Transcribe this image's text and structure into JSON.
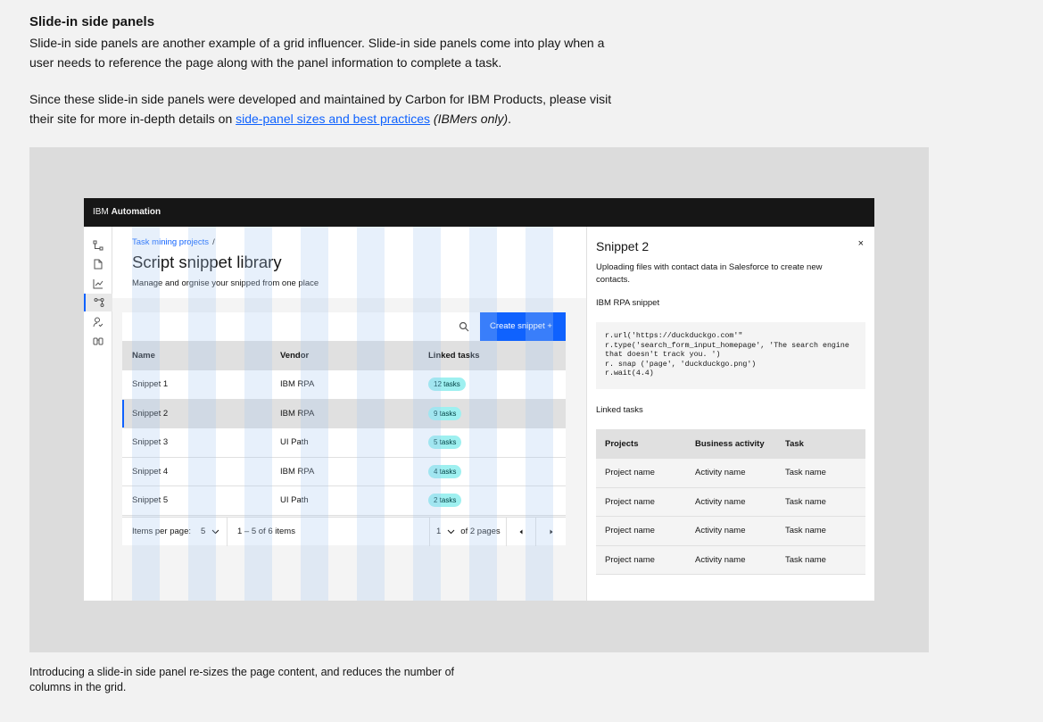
{
  "doc": {
    "heading": "Slide-in side panels",
    "para1": "Slide-in side panels are another example of a grid influencer. Slide-in side panels come into play when a user needs to reference the page along with the panel information to complete a task.",
    "para2_before": "Since these slide-in side panels were developed and maintained by Carbon for IBM Products, please visit their site for more in-depth details on ",
    "para2_link": "side-panel sizes and best practices",
    "para2_italic": "(IBMers only)",
    "para2_after": ".",
    "caption": "Introducing a slide-in side panel re-sizes the page content, and reduces the number of columns in the grid."
  },
  "app": {
    "brand_prefix": "IBM ",
    "brand_name": "Automation",
    "rail_icons": [
      "flow-icon",
      "document-icon",
      "chart-icon",
      "process-icon",
      "user-check-icon",
      "binoculars-icon"
    ],
    "breadcrumb": "Task mining projects",
    "breadcrumb_sep": "/",
    "title": "Script snippet library",
    "subtitle": "Manage and orgnise your snipped from one place",
    "create_button": "Create snippet +",
    "table": {
      "headers": [
        "Name",
        "Vendor",
        "Linked tasks"
      ],
      "rows": [
        {
          "name": "Snippet 1",
          "vendor": "IBM RPA",
          "tasks": "12 tasks"
        },
        {
          "name": "Snippet 2",
          "vendor": "IBM RPA",
          "tasks": "9 tasks"
        },
        {
          "name": "Snippet 3",
          "vendor": "UI Path",
          "tasks": "5 tasks"
        },
        {
          "name": "Snippet 4",
          "vendor": "IBM RPA",
          "tasks": "4 tasks"
        },
        {
          "name": "Snippet 5",
          "vendor": "UI Path",
          "tasks": "2 tasks"
        }
      ]
    },
    "pagination": {
      "items_per_page_label": "Items per page:",
      "items_per_page": "5",
      "range": "1 – 5 of 6 items",
      "page": "1",
      "of_pages": "of 2 pages"
    }
  },
  "panel": {
    "title": "Snippet 2",
    "close": "×",
    "description": "Uploading files with contact data in Salesforce to create new contacts.",
    "snippet_label": "IBM RPA snippet",
    "code": "r.url('https://duckduckgo.com'\"\nr.type('search_form_input_homepage', 'The search engine\nthat doesn't track you. ')\nr. snap ('page', 'duckduckgo.png')\nr.wait(4.4)",
    "linked_label": "Linked tasks",
    "table": {
      "headers": [
        "Projects",
        "Business activity",
        "Task"
      ],
      "rows": [
        {
          "project": "Project name",
          "activity": "Activity name",
          "task": "Task name"
        },
        {
          "project": "Project name",
          "activity": "Activity name",
          "task": "Task name"
        },
        {
          "project": "Project name",
          "activity": "Activity name",
          "task": "Task name"
        },
        {
          "project": "Project name",
          "activity": "Activity name",
          "task": "Task name"
        }
      ]
    }
  },
  "colors": {
    "accent": "#0f62fe",
    "header_bg": "#161616",
    "tag_bg": "#9ef0f0"
  }
}
